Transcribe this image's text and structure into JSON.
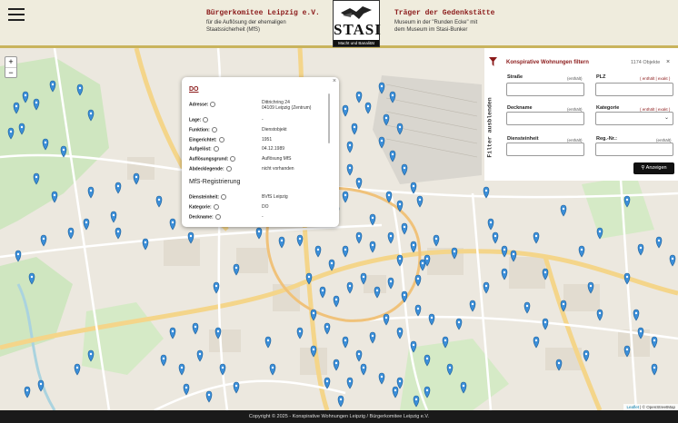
{
  "header": {
    "left_title": "Bürgerkomitee Leipzig e.V.",
    "left_lines": [
      "für die Auflösung der ehemaligen",
      "Staatssicherheit (MfS)"
    ],
    "right_title": "Träger der Gedenkstätte",
    "right_lines": [
      "Museum in der \"Runden Ecke\" mit",
      "dem Museum im Stasi-Bunker"
    ],
    "logo_word": "STASI",
    "logo_sub": "Macht und Banalität"
  },
  "map": {
    "zoom_in": "+",
    "zoom_out": "−",
    "attribution_leaflet": "Leaflet",
    "attribution_osm": "© OpenStreetMap",
    "pin_color": "#3b8ed8"
  },
  "popup": {
    "close": "×",
    "title": "DO",
    "rows": [
      {
        "label": "Adresse:",
        "value": "Dittrichring 24"
      },
      {
        "label": "Lage:",
        "value": "-"
      },
      {
        "label": "Funktion:",
        "value": "Dienstobjekt"
      },
      {
        "label": "Eingerichtet:",
        "value": "1951"
      },
      {
        "label": "Aufgelöst:",
        "value": "04.12.1989"
      },
      {
        "label": "Auflösungsgrund:",
        "value": "Auflösung MfS"
      },
      {
        "label": "Abdecklegende:",
        "value": "nicht vorhanden"
      }
    ],
    "address_line2": "04109 Leipzig (Zentrum)",
    "section_title": "MfS-Registrierung",
    "reg_rows": [
      {
        "label": "Diensteinheit:",
        "value": "BVfS Leipzig"
      },
      {
        "label": "Kategorie:",
        "value": "DO"
      },
      {
        "label": "Deckname:",
        "value": "-"
      }
    ]
  },
  "filter": {
    "title": "Konspirative Wohnungen filtern",
    "count": "1174 Objekte",
    "close": "×",
    "toggle_label": "Filter ausblenden",
    "fields": [
      {
        "label": "Straße",
        "opt": "(enthält)"
      },
      {
        "label": "PLZ",
        "opt": "( enthält | exakt )"
      },
      {
        "label": "Deckname",
        "opt": "(enthält)"
      },
      {
        "label": "Kategorie",
        "opt": "( enthält | exakt )"
      },
      {
        "label": "Diensteinheit",
        "opt": "(enthält)"
      },
      {
        "label": "Reg.-Nr.:",
        "opt": "(enthält)"
      }
    ],
    "search_label": "Anzeigen"
  },
  "footer": {
    "text": "Copyright © 2025 - Konspirative Wohnungen Leipzig / Bürgerkomitee Leipzig e.V."
  },
  "colors": {
    "accent": "#8b1a1a",
    "header_bg": "#efecdd",
    "header_border": "#c9b45c",
    "footer_bg": "#1a1a1a"
  }
}
